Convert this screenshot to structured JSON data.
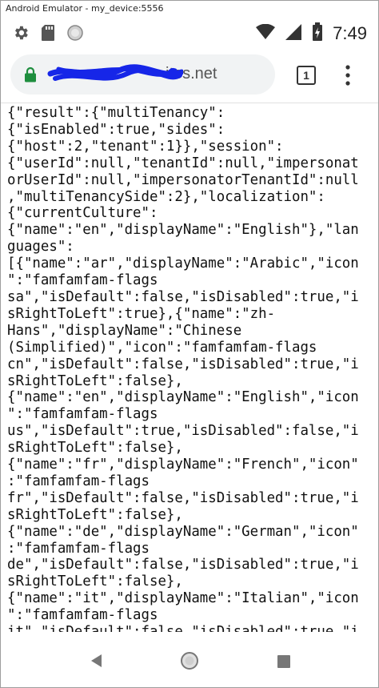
{
  "window": {
    "title": "Android Emulator - my_device:5556"
  },
  "status_bar": {
    "time": "7:49",
    "left_icons": [
      "gear-icon",
      "sd-card-icon",
      "circle-icon"
    ],
    "right_icons": [
      "wifi-icon",
      "signal-icon",
      "battery-icon"
    ]
  },
  "browser": {
    "url_visible": "ites.net",
    "tab_count": "1",
    "secure": true,
    "accent_lock_color": "#1e8e3e"
  },
  "content": {
    "lines": [
      "{\"result\":{\"multiTenancy\":",
      "{\"isEnabled\":true,\"sides\":",
      "{\"host\":2,\"tenant\":1}},\"session\":",
      "{\"userId\":null,\"tenantId\":null,\"impersonat",
      "orUserId\":null,\"impersonatorTenantId\":null",
      ",\"multiTenancySide\":2},\"localization\":",
      "{\"currentCulture\":",
      "{\"name\":\"en\",\"displayName\":\"English\"},\"lan",
      "guages\":",
      "[{\"name\":\"ar\",\"displayName\":\"Arabic\",\"icon",
      "\":\"famfamfam-flags",
      "sa\",\"isDefault\":false,\"isDisabled\":true,\"i",
      "sRightToLeft\":true},{\"name\":\"zh-",
      "Hans\",\"displayName\":\"Chinese",
      "(Simplified)\",\"icon\":\"famfamfam-flags",
      "cn\",\"isDefault\":false,\"isDisabled\":true,\"i",
      "sRightToLeft\":false},",
      "{\"name\":\"en\",\"displayName\":\"English\",\"icon",
      "\":\"famfamfam-flags",
      "us\",\"isDefault\":true,\"isDisabled\":false,\"i",
      "sRightToLeft\":false},",
      "{\"name\":\"fr\",\"displayName\":\"French\",\"icon\"",
      ":\"famfamfam-flags",
      "fr\",\"isDefault\":false,\"isDisabled\":true,\"i",
      "sRightToLeft\":false},",
      "{\"name\":\"de\",\"displayName\":\"German\",\"icon\"",
      ":\"famfamfam-flags",
      "de\",\"isDefault\":false,\"isDisabled\":true,\"i",
      "sRightToLeft\":false},",
      "{\"name\":\"it\",\"displayName\":\"Italian\",\"icon",
      "\":\"famfamfam-flags",
      "it\",\"isDefault\":false,\"isDisabled\":true,\"i"
    ]
  },
  "nav_bar": {
    "buttons": [
      "back-icon",
      "home-icon",
      "recents-icon"
    ]
  }
}
